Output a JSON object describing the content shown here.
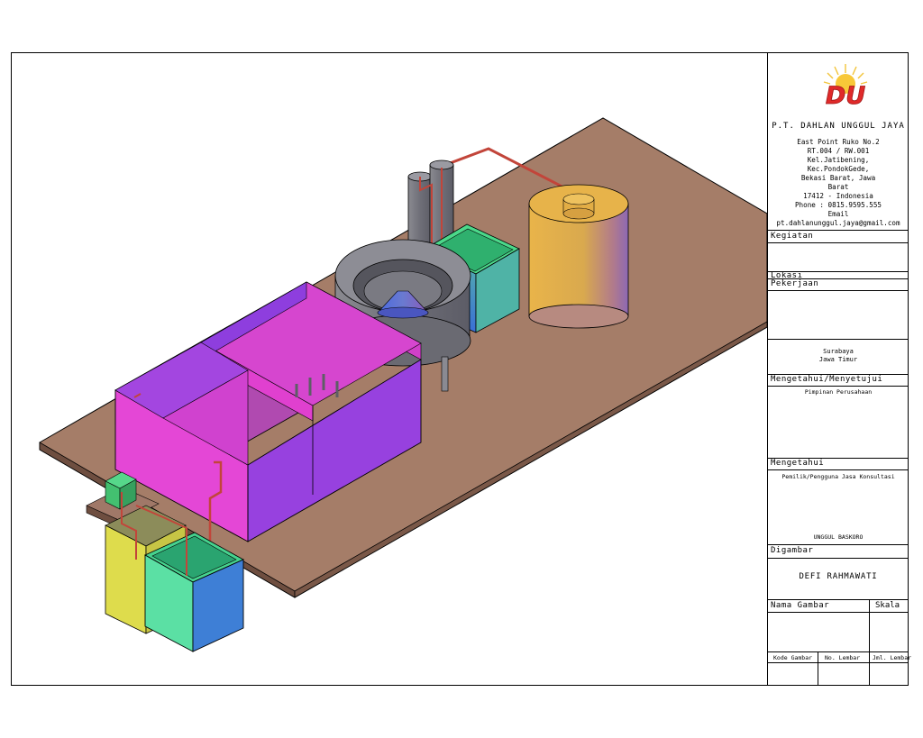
{
  "company": {
    "logo_text": "DU",
    "name": "P.T.  DAHLAN  UNGGUL  JAYA",
    "address_lines": [
      "East  Point  Ruko  No.2",
      "RT.004  /  RW.001",
      "Kel.Jatibening,",
      "Kec.PondokGede,",
      "Bekasi  Barat,  Jawa",
      "Barat",
      "17412  -  Indonesia",
      "Phone  :  0815.9595.555",
      "Email",
      "pt.dahlanunggul.jaya@gmail.com"
    ]
  },
  "titleblock": {
    "kegiatan_label": "Kegiatan",
    "lokasi_label": "Lokasi",
    "pekerjaan_label": "Pekerjaan",
    "location_lines": [
      "Surabaya",
      "Jawa  Timur"
    ],
    "approval_label": "Mengetahui/Menyetujui",
    "approval_role": "Pimpinan  Perusahaan",
    "mengetahui_label": "Mengetahui",
    "mengetahui_role": "Pemilik/Pengguna  Jasa  Konsultasi",
    "mengetahui_name": "UNGGUL  BASKORO",
    "digambar_label": "Digambar",
    "digambar_name": "DEFI  RAHMAWATI",
    "nama_gambar_label": "Nama  Gambar",
    "skala_label": "Skala",
    "kode_gambar_label": "Kode  Gambar",
    "no_lembar_label": "No.  Lembar",
    "jml_lembar_label": "Jml.  Lembar"
  },
  "colors": {
    "slab_top": "#a57d68",
    "slab_edge": "#6e4e40",
    "magenta": "#dc3cd8",
    "purple": "#9a3ee0",
    "tank_orange": "#e7b34a",
    "green": "#56e38c",
    "blue": "#3e7fd6",
    "yellow": "#dedc4c",
    "clarifier_gray": "#7d7d86",
    "pipe_red": "#c2453a"
  },
  "icons": [
    "du-logo-icon"
  ]
}
